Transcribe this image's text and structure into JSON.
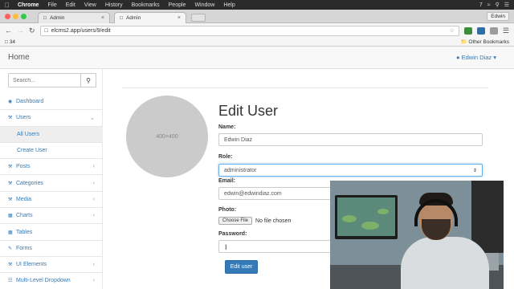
{
  "os_menubar": {
    "app_name": "Chrome",
    "items": [
      "File",
      "Edit",
      "View",
      "History",
      "Bookmarks",
      "People",
      "Window",
      "Help"
    ],
    "status_text": "7"
  },
  "browser": {
    "tabs": [
      {
        "title": "Admin",
        "active": false
      },
      {
        "title": "Admin",
        "active": true
      }
    ],
    "profile_name": "Edwin",
    "url": "elcms2.app/users/9/edit",
    "bookmark_count": "34",
    "other_bookmarks": "Other Bookmarks"
  },
  "app": {
    "brand": "Home",
    "user_menu": "Edwin Diaz"
  },
  "sidebar": {
    "search_placeholder": "Search...",
    "items": [
      {
        "label": "Dashboard",
        "icon": "dashboard-icon",
        "expandable": false
      },
      {
        "label": "Users",
        "icon": "wrench-icon",
        "expandable": true
      },
      {
        "label": "All Users",
        "sub": true,
        "active": true
      },
      {
        "label": "Create User",
        "sub": true,
        "active": false
      },
      {
        "label": "Posts",
        "icon": "wrench-icon",
        "expandable": true
      },
      {
        "label": "Categories",
        "icon": "wrench-icon",
        "expandable": true
      },
      {
        "label": "Media",
        "icon": "wrench-icon",
        "expandable": true
      },
      {
        "label": "Charts",
        "icon": "bar-chart-icon",
        "expandable": true
      },
      {
        "label": "Tables",
        "icon": "table-icon",
        "expandable": false
      },
      {
        "label": "Forms",
        "icon": "edit-icon",
        "expandable": false
      },
      {
        "label": "UI Elements",
        "icon": "wrench-icon",
        "expandable": true
      },
      {
        "label": "Multi-Level Dropdown",
        "icon": "sitemap-icon",
        "expandable": true
      }
    ]
  },
  "form": {
    "heading": "Edit User",
    "avatar_placeholder": "400×400",
    "name_label": "Name:",
    "name_value": "Edwin Diaz",
    "role_label": "Role:",
    "role_value": "administrator",
    "email_label": "Email:",
    "email_value": "edwin@edwindiaz.com",
    "photo_label": "Photo:",
    "choose_file": "Choose File",
    "no_file": "No file chosen",
    "password_label": "Password:",
    "submit_label": "Edit user"
  },
  "colors": {
    "link": "#337ab7",
    "primary_button": "#337ab7",
    "focus_border": "#66afe9"
  }
}
